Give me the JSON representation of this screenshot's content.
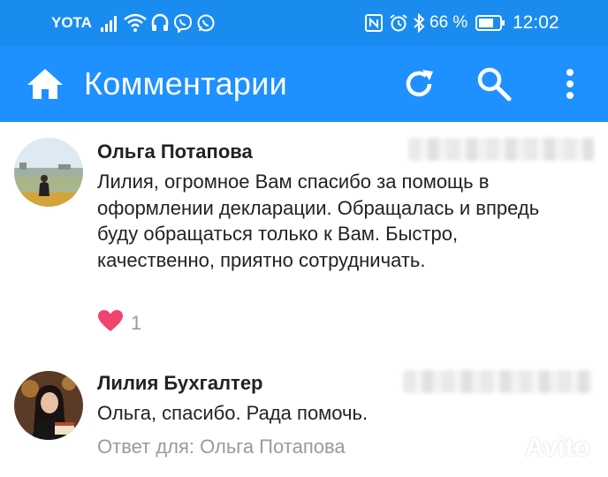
{
  "status_bar": {
    "carrier": "YOTA",
    "battery_percent": "66 %",
    "time": "12:02",
    "icons": [
      "signal-icon",
      "wifi-icon",
      "headphones-icon",
      "viber-icon",
      "whatsapp-icon",
      "nfc-icon",
      "alarm-icon",
      "bluetooth-icon",
      "battery-icon"
    ]
  },
  "app_bar": {
    "title": "Комментарии",
    "icons": [
      "home-icon",
      "refresh-icon",
      "search-icon",
      "more-vert-icon"
    ],
    "color": "#1e90ff"
  },
  "comments": [
    {
      "author": "Ольга Потапова",
      "date": "",
      "text": "Лилия, огромное Вам спасибо за помощь в оформлении декларации. Обращалась и впредь буду обращаться только к Вам. Быстро, качественно, приятно сотрудничать.",
      "likes": "1"
    },
    {
      "author": "Лилия Бухгалтер",
      "date": "",
      "text": "Ольга, спасибо. Рада помочь.",
      "reply_to": "Ответ для: Ольга Потапова"
    }
  ],
  "watermark": "Avito",
  "colors": {
    "like": "#f0446e",
    "meta": "#9a9a9a",
    "text": "#222222"
  }
}
